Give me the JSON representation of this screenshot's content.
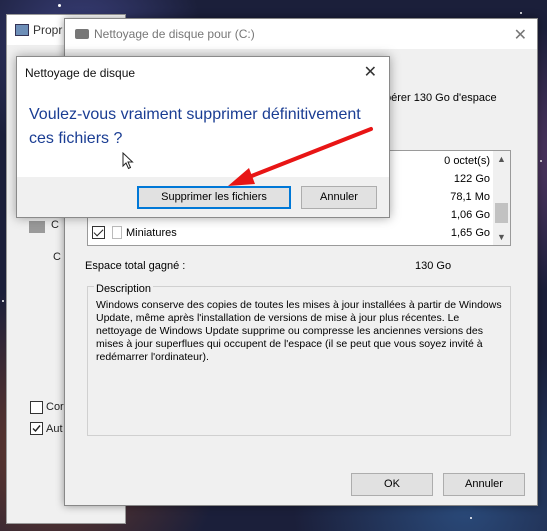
{
  "properties_window": {
    "title_partial": "Propr",
    "checkbox1_label_partial": "Cor",
    "checkbox2_label_partial": "Aut",
    "checkbox2_checked": true,
    "side_text1": "C",
    "side_text2": "C"
  },
  "disk_cleanup": {
    "title": "Nettoyage de disque pour  (C:)",
    "partial_text": "pérer 130 Go d'espace",
    "files": [
      {
        "name": "",
        "size": "0 octet(s)",
        "checked": false,
        "visible": false
      },
      {
        "name": "",
        "size": "122 Go",
        "checked": false,
        "visible": false
      },
      {
        "name": "",
        "size": "78,1 Mo",
        "checked": false,
        "visible": false
      },
      {
        "name": "",
        "size": "1,06 Go",
        "checked": false,
        "visible": false
      },
      {
        "name": "Miniatures",
        "size": "1,65 Go",
        "checked": true,
        "visible": true
      }
    ],
    "space_label": "Espace total gagné :",
    "space_value": "130 Go",
    "description_legend": "Description",
    "description_text": "Windows conserve des copies de toutes les mises à jour installées à partir de Windows Update, même après l'installation de versions de mise à jour plus récentes. Le nettoyage de Windows Update supprime ou compresse les anciennes versions des mises à jour superflues qui occupent de l'espace (il se peut que vous soyez invité à redémarrer l'ordinateur).",
    "ok_label": "OK",
    "cancel_label": "Annuler"
  },
  "confirm_dialog": {
    "title": "Nettoyage de disque",
    "question": "Voulez-vous vraiment supprimer définitivement ces fichiers ?",
    "delete_label": "Supprimer les fichiers",
    "cancel_label": "Annuler"
  },
  "icons": [
    "close-icon",
    "disk-cleanup-icon",
    "properties-icon",
    "file-icon",
    "scroll-up-icon",
    "scroll-down-icon",
    "red-arrow-annotation",
    "mouse-cursor-icon"
  ],
  "colors": {
    "question_text": "#1a3d93",
    "primary_border": "#0078d7",
    "annotation_arrow": "#e81515"
  }
}
